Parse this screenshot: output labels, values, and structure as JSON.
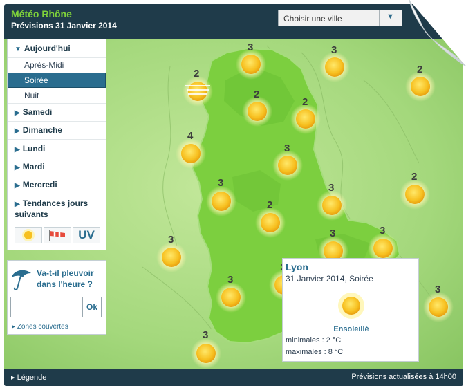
{
  "header": {
    "title": "Météo Rhône",
    "subtitle": "Prévisions 31 Janvier 2014",
    "city_select_label": "Choisir une ville"
  },
  "sidebar": {
    "items": [
      {
        "label": "Aujourd'hui",
        "level": "main",
        "expanded": true
      },
      {
        "label": "Après-Midi",
        "level": "sub"
      },
      {
        "label": "Soirée",
        "level": "sub",
        "active": true
      },
      {
        "label": "Nuit",
        "level": "sub"
      },
      {
        "label": "Samedi",
        "level": "main"
      },
      {
        "label": "Dimanche",
        "level": "main"
      },
      {
        "label": "Lundi",
        "level": "main"
      },
      {
        "label": "Mardi",
        "level": "main"
      },
      {
        "label": "Mercredi",
        "level": "main"
      },
      {
        "label": "Tendances jours suivants",
        "level": "main"
      }
    ],
    "view_tabs": {
      "sun": "sun-icon",
      "wind": "windsock-icon",
      "uv": "UV"
    }
  },
  "rain": {
    "question": "Va-t-il pleuvoir dans l'heure ?",
    "input_value": "",
    "ok_label": "Ok",
    "zones_label": "Zones couvertes"
  },
  "map": {
    "markers": [
      {
        "value": "3"
      },
      {
        "value": "3"
      },
      {
        "value": "2"
      },
      {
        "value": "2"
      },
      {
        "value": "2"
      },
      {
        "value": "2"
      },
      {
        "value": "4"
      },
      {
        "value": "3"
      },
      {
        "value": "2"
      },
      {
        "value": "3"
      },
      {
        "value": "3"
      },
      {
        "value": "2"
      },
      {
        "value": "3"
      },
      {
        "value": "3"
      },
      {
        "value": "3"
      },
      {
        "value": "3"
      },
      {
        "value": "2"
      },
      {
        "value": "3"
      },
      {
        "value": "3"
      }
    ]
  },
  "forecast_card": {
    "city": "Lyon",
    "date": "31 Janvier 2014, Soirée",
    "condition": "Ensoleillé",
    "min": "minimales : 2 °C",
    "max": "maximales : 8 °C"
  },
  "footer": {
    "legend": "Légende",
    "updated": "Prévisions actualisées à 14h00"
  },
  "colors": {
    "brand_dark": "#1f3b4a",
    "accent_green": "#7fd23a",
    "selected": "#2a6d8f",
    "sun": "#f7c020"
  }
}
